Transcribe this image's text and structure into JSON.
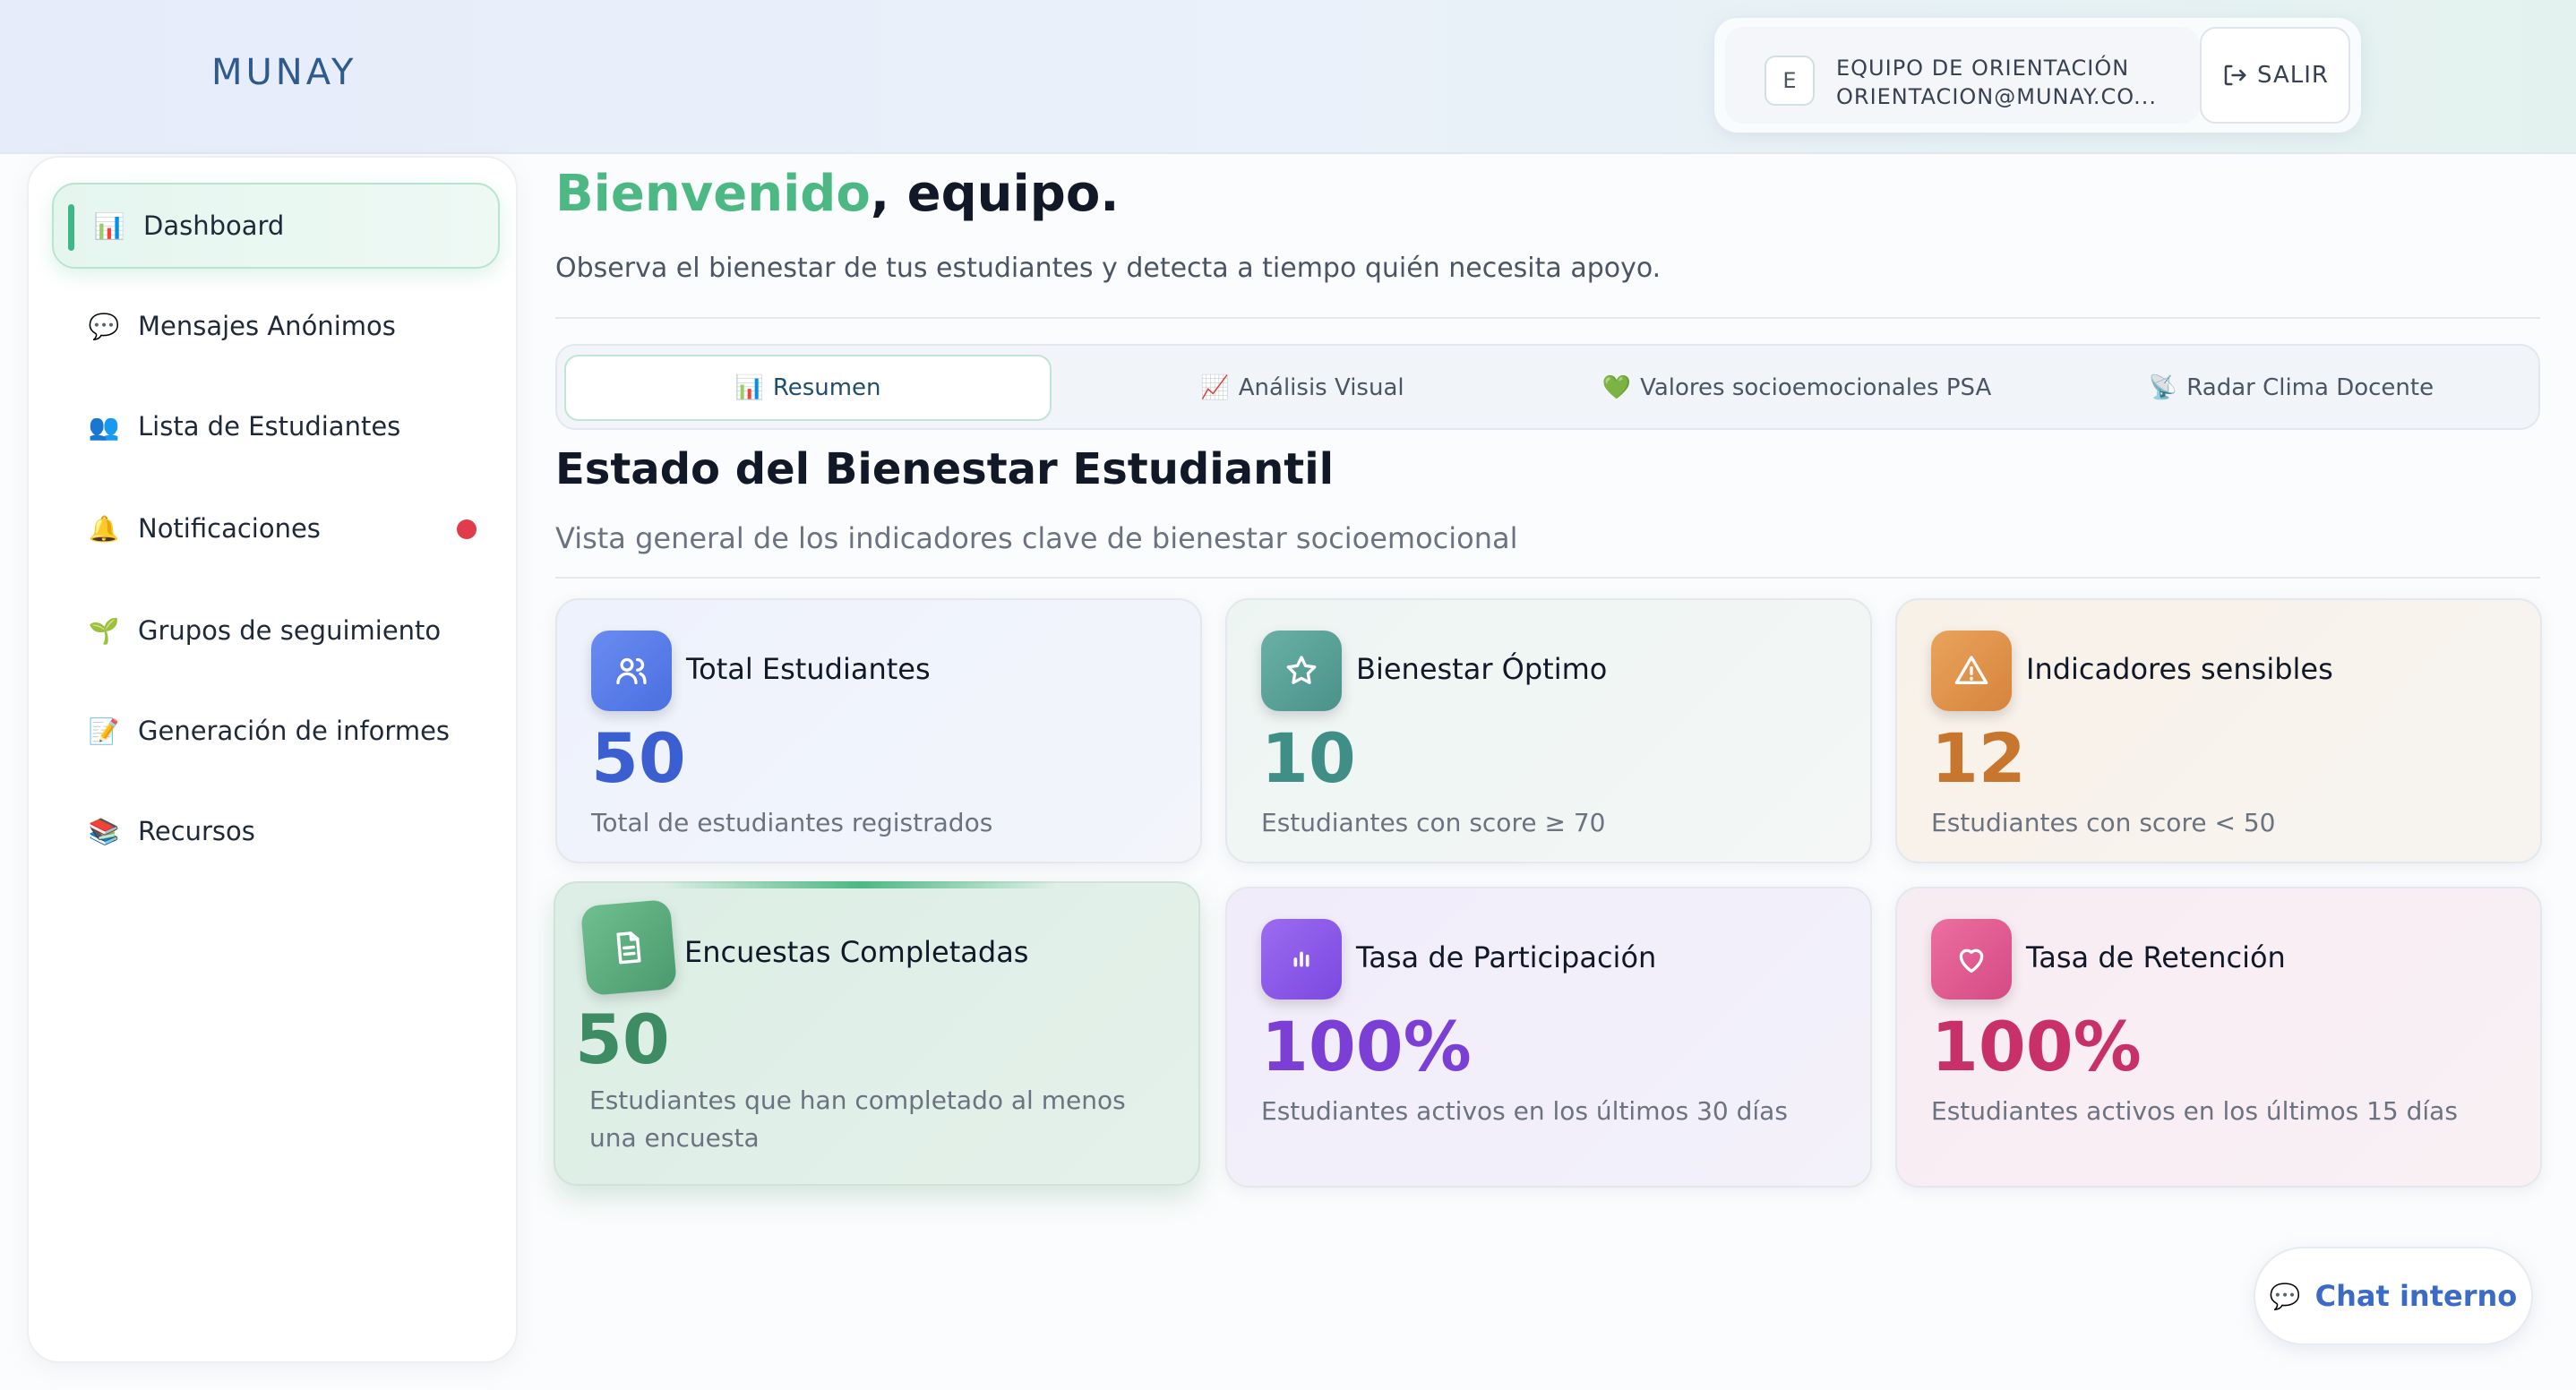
{
  "header": {
    "brand": "MUNAY",
    "user_initial": "E",
    "user_name": "EQUIPO DE ORIENTACIÓN",
    "user_email": "ORIENTACION@MUNAY.CO...",
    "logout_label": "SALIR"
  },
  "sidebar": {
    "items": [
      {
        "icon": "📊",
        "label": "Dashboard"
      },
      {
        "icon": "💬",
        "label": "Mensajes Anónimos"
      },
      {
        "icon": "👥",
        "label": "Lista de Estudiantes"
      },
      {
        "icon": "🔔",
        "label": "Notificaciones"
      },
      {
        "icon": "🌱",
        "label": "Grupos de seguimiento"
      },
      {
        "icon": "📝",
        "label": "Generación de informes"
      },
      {
        "icon": "📚",
        "label": "Recursos"
      }
    ]
  },
  "welcome": {
    "highlight": "Bienvenido",
    "rest": ", equipo.",
    "subtitle": "Observa el bienestar de tus estudiantes y detecta a tiempo quién necesita apoyo."
  },
  "tabs": [
    {
      "icon": "📊",
      "label": "Resumen"
    },
    {
      "icon": "📈",
      "label": "Análisis Visual"
    },
    {
      "icon": "💚",
      "label": "Valores socioemocionales PSA"
    },
    {
      "icon": "📡",
      "label": "Radar Clima Docente"
    }
  ],
  "section": {
    "title": "Estado del Bienestar Estudiantil",
    "subtitle": "Vista general de los indicadores clave de bienestar socioemocional"
  },
  "cards": [
    {
      "title": "Total Estudiantes",
      "value": "50",
      "desc": "Total de estudiantes registrados",
      "icon": "users-icon",
      "color": "#3b5fd1"
    },
    {
      "title": "Bienestar Óptimo",
      "value": "10",
      "desc": "Estudiantes con score ≥ 70",
      "icon": "star-icon",
      "color": "#3f8f86"
    },
    {
      "title": "Indicadores sensibles",
      "value": "12",
      "desc": "Estudiantes con score < 50",
      "icon": "warning-icon",
      "color": "#c8762e"
    },
    {
      "title": "Encuestas Completadas",
      "value": "50",
      "desc": "Estudiantes que han completado al menos una encuesta",
      "icon": "document-icon",
      "color": "#3d8c64"
    },
    {
      "title": "Tasa de Participación",
      "value": "100%",
      "desc": "Estudiantes activos en los últimos 30 días",
      "icon": "bar-chart-icon",
      "color": "#7c3fd6"
    },
    {
      "title": "Tasa de Retención",
      "value": "100%",
      "desc": "Estudiantes activos en los últimos 15 días",
      "icon": "heart-icon",
      "color": "#c8306a"
    }
  ],
  "chat": {
    "icon": "💬",
    "label": "Chat interno"
  }
}
